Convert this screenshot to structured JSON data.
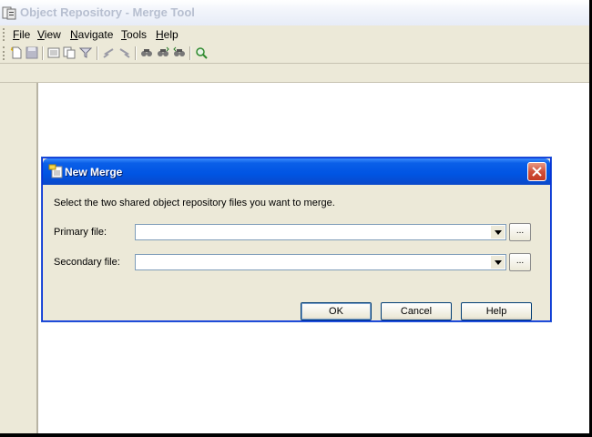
{
  "window": {
    "title": "Object Repository - Merge Tool"
  },
  "menubar": {
    "items": [
      {
        "label": "File",
        "hotkey": "F",
        "rest": "ile"
      },
      {
        "label": "View",
        "hotkey": "V",
        "rest": "iew"
      },
      {
        "label": "Navigate",
        "hotkey": "N",
        "rest": "avigate"
      },
      {
        "label": "Tools",
        "hotkey": "T",
        "rest": "ools"
      },
      {
        "label": "Help",
        "hotkey": "H",
        "rest": "elp"
      }
    ]
  },
  "toolbar": {
    "icons": [
      "new-icon",
      "save-icon",
      "properties-icon",
      "copy-icon",
      "filter-icon",
      "previous-conflict-icon",
      "next-conflict-icon",
      "find-icon",
      "find-next-icon",
      "find-previous-icon",
      "refresh-icon"
    ]
  },
  "dialog": {
    "title": "New Merge",
    "instruction": "Select the two shared object repository files you want to merge.",
    "primary_label": "Primary file:",
    "primary_value": "",
    "secondary_label": "Secondary file:",
    "secondary_value": "",
    "browse_label": "...",
    "ok_label": "OK",
    "cancel_label": "Cancel",
    "help_label": "Help"
  },
  "colors": {
    "dialog_title_blue": "#0054e3",
    "close_red": "#d0503a",
    "chrome": "#ece9d8"
  }
}
